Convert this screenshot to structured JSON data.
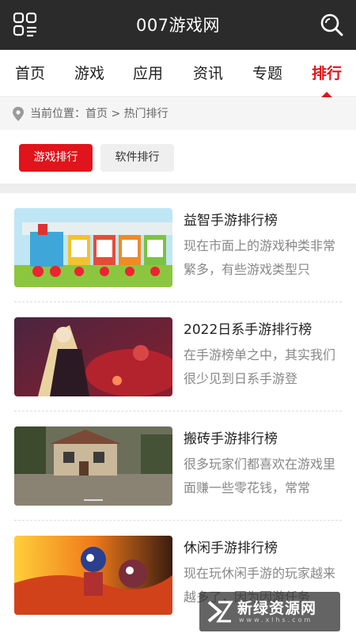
{
  "header": {
    "title": "007游戏网",
    "menu_icon": "grid-menu-icon",
    "search_icon": "search-icon"
  },
  "nav": {
    "tabs": [
      {
        "label": "首页"
      },
      {
        "label": "游戏"
      },
      {
        "label": "应用"
      },
      {
        "label": "资讯"
      },
      {
        "label": "专题"
      },
      {
        "label": "排行"
      }
    ],
    "active_index": 5
  },
  "breadcrumb": {
    "text": "当前位置：首页 > 热门排行"
  },
  "rank_tabs": {
    "game": "游戏排行",
    "software": "软件排行"
  },
  "items": [
    {
      "title": "益智手游排行榜",
      "desc": "现在市面上的游戏种类非常繁多，有些游戏类型只"
    },
    {
      "title": "2022日系手游排行榜",
      "desc": "在手游榜单之中，其实我们很少见到日系手游登"
    },
    {
      "title": "搬砖手游排行榜",
      "desc": "很多玩家们都喜欢在游戏里面赚一些零花钱，常常"
    },
    {
      "title": "休闲手游排行榜",
      "desc": "现在玩休闲手游的玩家越来越多了，因为因游任务"
    }
  ],
  "watermark": {
    "text": "新绿资源网",
    "sub": "www.xlhs.com"
  },
  "colors": {
    "accent": "#e0141a",
    "header_bg": "#2b2b2b"
  }
}
